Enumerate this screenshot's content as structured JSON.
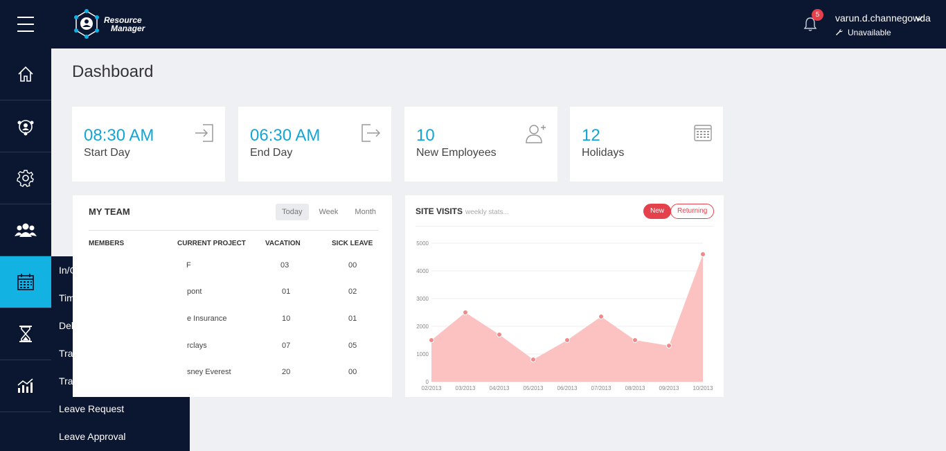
{
  "app": {
    "logo_line1": "Resource",
    "logo_line2": "Manager"
  },
  "header": {
    "notification_count": "5",
    "user_name": "varun.d.channegowda",
    "user_status": "Unavailable"
  },
  "sidebar": {
    "items": [
      "home-icon",
      "team-network-icon",
      "gear-icon",
      "people-group-icon",
      "calendar-icon",
      "hourglass-icon",
      "analytics-icon"
    ],
    "active_index": 4
  },
  "flyout": {
    "items": [
      "In/Out",
      "Timecard",
      "Delegate",
      "Transfer Reportees",
      "Trash Collector",
      "Leave Request",
      "Leave Approval"
    ]
  },
  "page": {
    "title": "Dashboard"
  },
  "stats": [
    {
      "value": "08:30 AM",
      "label": "Start Day",
      "icon": "sign-in-icon"
    },
    {
      "value": "06:30 AM",
      "label": "End Day",
      "icon": "sign-out-icon"
    },
    {
      "value": "10",
      "label": "New Employees",
      "icon": "add-user-icon"
    },
    {
      "value": "12",
      "label": "Holidays",
      "icon": "calendar-icon"
    }
  ],
  "team": {
    "title": "MY TEAM",
    "tabs": [
      "Today",
      "Week",
      "Month"
    ],
    "active_tab": 0,
    "columns": [
      "MEMBERS",
      "CURRENT PROJECT",
      "VACATION",
      "SICK LEAVE"
    ],
    "rows": [
      {
        "project": "F",
        "vacation": "03",
        "sick": "00"
      },
      {
        "project": "pont",
        "vacation": "01",
        "sick": "02"
      },
      {
        "project": "e Insurance",
        "vacation": "10",
        "sick": "01"
      },
      {
        "project": "rclays",
        "vacation": "07",
        "sick": "05"
      },
      {
        "project": "sney Everest",
        "vacation": "20",
        "sick": "00"
      }
    ]
  },
  "site_visits": {
    "title": "SITE VISITS",
    "subtitle": "weekly stats...",
    "buttons": [
      "New",
      "Returning"
    ],
    "fill_color": "#fcc2c2",
    "point_color": "#f08a8a"
  },
  "chart_data": {
    "type": "area",
    "title": "SITE VISITS",
    "x": [
      "02/2013",
      "03/2013",
      "04/2013",
      "05/2013",
      "06/2013",
      "07/2013",
      "08/2013",
      "09/2013",
      "10/2013"
    ],
    "series": [
      {
        "name": "New",
        "values": [
          1500,
          2500,
          1700,
          800,
          1500,
          2350,
          1500,
          1300,
          4600
        ]
      }
    ],
    "ylim": [
      0,
      5000
    ],
    "yticks": [
      0,
      1000,
      2000,
      3000,
      4000,
      5000
    ],
    "grid": true
  }
}
